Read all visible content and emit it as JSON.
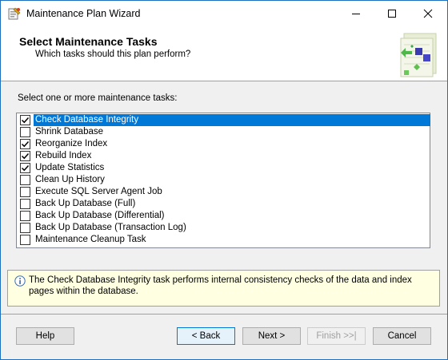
{
  "window": {
    "title": "Maintenance Plan Wizard",
    "icons": {
      "app": "wizard-app-icon",
      "minimize": "minimize-icon",
      "maximize": "maximize-icon",
      "close": "close-icon"
    }
  },
  "header": {
    "title": "Select Maintenance Tasks",
    "subtitle": "Which tasks should this plan perform?",
    "art_icon": "wizard-banner-icon"
  },
  "instruction": "Select one or more maintenance tasks:",
  "tasks": [
    {
      "label": "Check Database Integrity",
      "checked": true,
      "selected": true
    },
    {
      "label": "Shrink Database",
      "checked": false
    },
    {
      "label": "Reorganize Index",
      "checked": true
    },
    {
      "label": "Rebuild Index",
      "checked": true
    },
    {
      "label": "Update Statistics",
      "checked": true
    },
    {
      "label": "Clean Up History",
      "checked": false
    },
    {
      "label": "Execute SQL Server Agent Job",
      "checked": false
    },
    {
      "label": "Back Up Database (Full)",
      "checked": false
    },
    {
      "label": "Back Up Database (Differential)",
      "checked": false
    },
    {
      "label": "Back Up Database (Transaction Log)",
      "checked": false
    },
    {
      "label": "Maintenance Cleanup Task",
      "checked": false
    }
  ],
  "description": "The Check Database Integrity task performs internal consistency checks of the data and index pages within the database.",
  "buttons": {
    "help": "Help",
    "back": "< Back",
    "next": "Next >",
    "finish": "Finish >>|",
    "cancel": "Cancel"
  },
  "colors": {
    "selection": "#0078d7",
    "info_background": "#ffffe1",
    "window_border": "#1e6fbd"
  }
}
